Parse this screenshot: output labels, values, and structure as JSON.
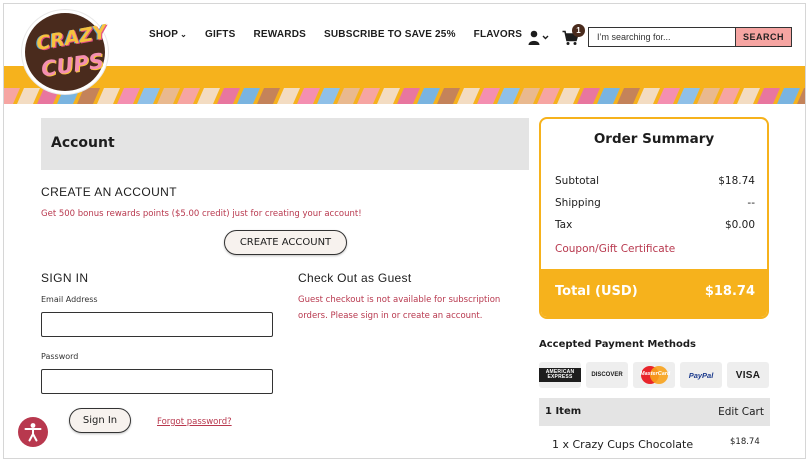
{
  "brand": {
    "logo_line1": "CRAZY",
    "logo_line2": "CUPS"
  },
  "nav": {
    "items": [
      {
        "label": "SHOP",
        "has_dropdown": true
      },
      {
        "label": "GIFTS"
      },
      {
        "label": "REWARDS"
      },
      {
        "label": "SUBSCRIBE TO SAVE 25%"
      },
      {
        "label": "FLAVORS"
      }
    ]
  },
  "header": {
    "cart_count": "1",
    "search_placeholder": "I’m searching for...",
    "search_button": "SEARCH"
  },
  "colors": {
    "accent": "#f6b21c",
    "link": "#b8384e",
    "brand_brown": "#4a2b1d",
    "search_button": "#f6a5a2"
  },
  "account": {
    "title": "Account",
    "create_heading": "CREATE AN ACCOUNT",
    "create_promo": "Get 500 bonus rewards points ($5.00 credit) just for creating your account!",
    "create_button": "CREATE ACCOUNT",
    "signin_heading": "SIGN IN",
    "email_label": "Email Address",
    "email_value": "",
    "password_label": "Password",
    "password_value": "",
    "signin_button": "Sign In",
    "forgot_link": "Forgot password?",
    "guest_heading": "Check Out as Guest",
    "guest_message_line1": "Guest checkout is not available for subscription",
    "guest_message_line2": "orders. Please sign in or create an account."
  },
  "summary": {
    "title": "Order Summary",
    "rows": [
      {
        "label": "Subtotal",
        "value": "$18.74"
      },
      {
        "label": "Shipping",
        "value": "--"
      },
      {
        "label": "Tax",
        "value": "$0.00"
      }
    ],
    "coupon_link": "Coupon/Gift Certificate",
    "total_label": "Total (USD)",
    "total_value": "$18.74"
  },
  "payment": {
    "title": "Accepted Payment Methods",
    "methods": [
      "AMERICAN EXPRESS",
      "DISCOVER",
      "MasterCard",
      "PayPal",
      "VISA"
    ]
  },
  "cart": {
    "count_label": "1 Item",
    "edit_label": "Edit Cart",
    "line_item": "1 x Crazy Cups Chocolate",
    "line_price": "$18.74"
  }
}
